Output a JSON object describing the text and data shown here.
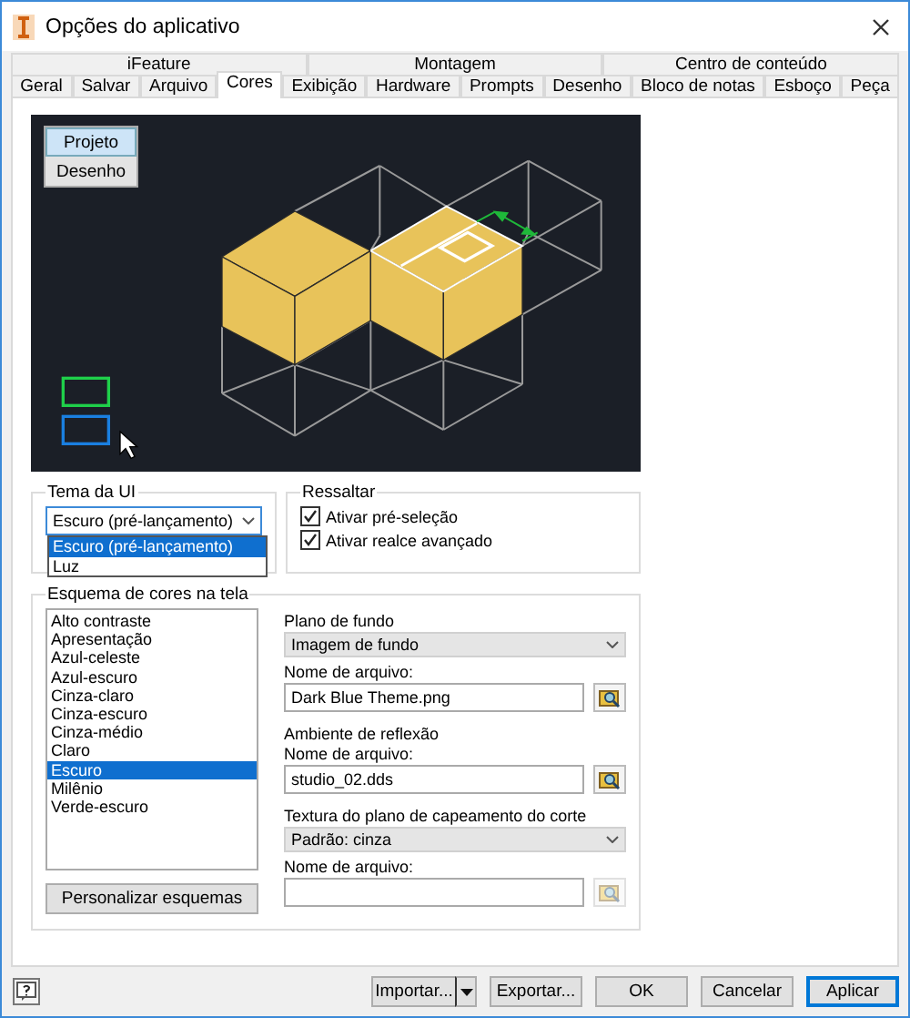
{
  "window": {
    "title": "Opções do aplicativo"
  },
  "tab_groups": [
    "iFeature",
    "Montagem",
    "Centro de conteúdo"
  ],
  "tabs": [
    {
      "label": "Geral",
      "selected": false
    },
    {
      "label": "Salvar",
      "selected": false
    },
    {
      "label": "Arquivo",
      "selected": false
    },
    {
      "label": "Cores",
      "selected": true
    },
    {
      "label": "Exibição",
      "selected": false
    },
    {
      "label": "Hardware",
      "selected": false
    },
    {
      "label": "Prompts",
      "selected": false
    },
    {
      "label": "Desenho",
      "selected": false
    },
    {
      "label": "Bloco de notas",
      "selected": false
    },
    {
      "label": "Esboço",
      "selected": false
    },
    {
      "label": "Peça",
      "selected": false
    }
  ],
  "preview": {
    "view_buttons": [
      {
        "label": "Projeto",
        "selected": true
      },
      {
        "label": "Desenho",
        "selected": false
      }
    ]
  },
  "ui_theme": {
    "title": "Tema da UI",
    "value": "Escuro (pré-lançamento)",
    "options": [
      {
        "label": "Escuro (pré-lançamento)",
        "selected": true
      },
      {
        "label": "Luz",
        "selected": false
      }
    ]
  },
  "highlight": {
    "title": "Ressaltar",
    "options": [
      {
        "label": "Ativar pré-seleção",
        "checked": true
      },
      {
        "label": "Ativar realce avançado",
        "checked": true
      }
    ]
  },
  "color_scheme": {
    "title": "Esquema de cores na tela",
    "items": [
      {
        "label": "Alto contraste",
        "selected": false
      },
      {
        "label": "Apresentação",
        "selected": false
      },
      {
        "label": "Azul-celeste",
        "selected": false
      },
      {
        "label": "Azul-escuro",
        "selected": false
      },
      {
        "label": "Cinza-claro",
        "selected": false
      },
      {
        "label": "Cinza-escuro",
        "selected": false
      },
      {
        "label": "Cinza-médio",
        "selected": false
      },
      {
        "label": "Claro",
        "selected": false
      },
      {
        "label": "Escuro",
        "selected": true
      },
      {
        "label": "Milênio",
        "selected": false
      },
      {
        "label": "Verde-escuro",
        "selected": false
      }
    ],
    "button": "Personalizar esquemas"
  },
  "settings": [
    {
      "kind": "label",
      "text": "Plano de fundo"
    },
    {
      "kind": "select",
      "value": "Imagem de fundo"
    },
    {
      "kind": "label",
      "text": "Nome de arquivo:"
    },
    {
      "kind": "file",
      "value": "Dark Blue Theme.png",
      "disabled": false
    },
    {
      "kind": "heading",
      "text": "Ambiente de reflexão"
    },
    {
      "kind": "label",
      "text": "Nome de arquivo:"
    },
    {
      "kind": "file",
      "value": "studio_02.dds",
      "disabled": false
    },
    {
      "kind": "heading",
      "text": "Textura do plano de capeamento do corte"
    },
    {
      "kind": "select",
      "value": "Padrão: cinza"
    },
    {
      "kind": "label",
      "text": "Nome de arquivo:"
    },
    {
      "kind": "file",
      "disabled": true
    }
  ],
  "footer": {
    "buttons": [
      {
        "label": "Importar...",
        "kind": "split"
      },
      {
        "label": "Exportar...",
        "kind": "plain"
      },
      {
        "label": "OK",
        "kind": "plain"
      },
      {
        "label": "Cancelar",
        "kind": "plain"
      },
      {
        "label": "Aplicar",
        "kind": "default"
      }
    ]
  }
}
